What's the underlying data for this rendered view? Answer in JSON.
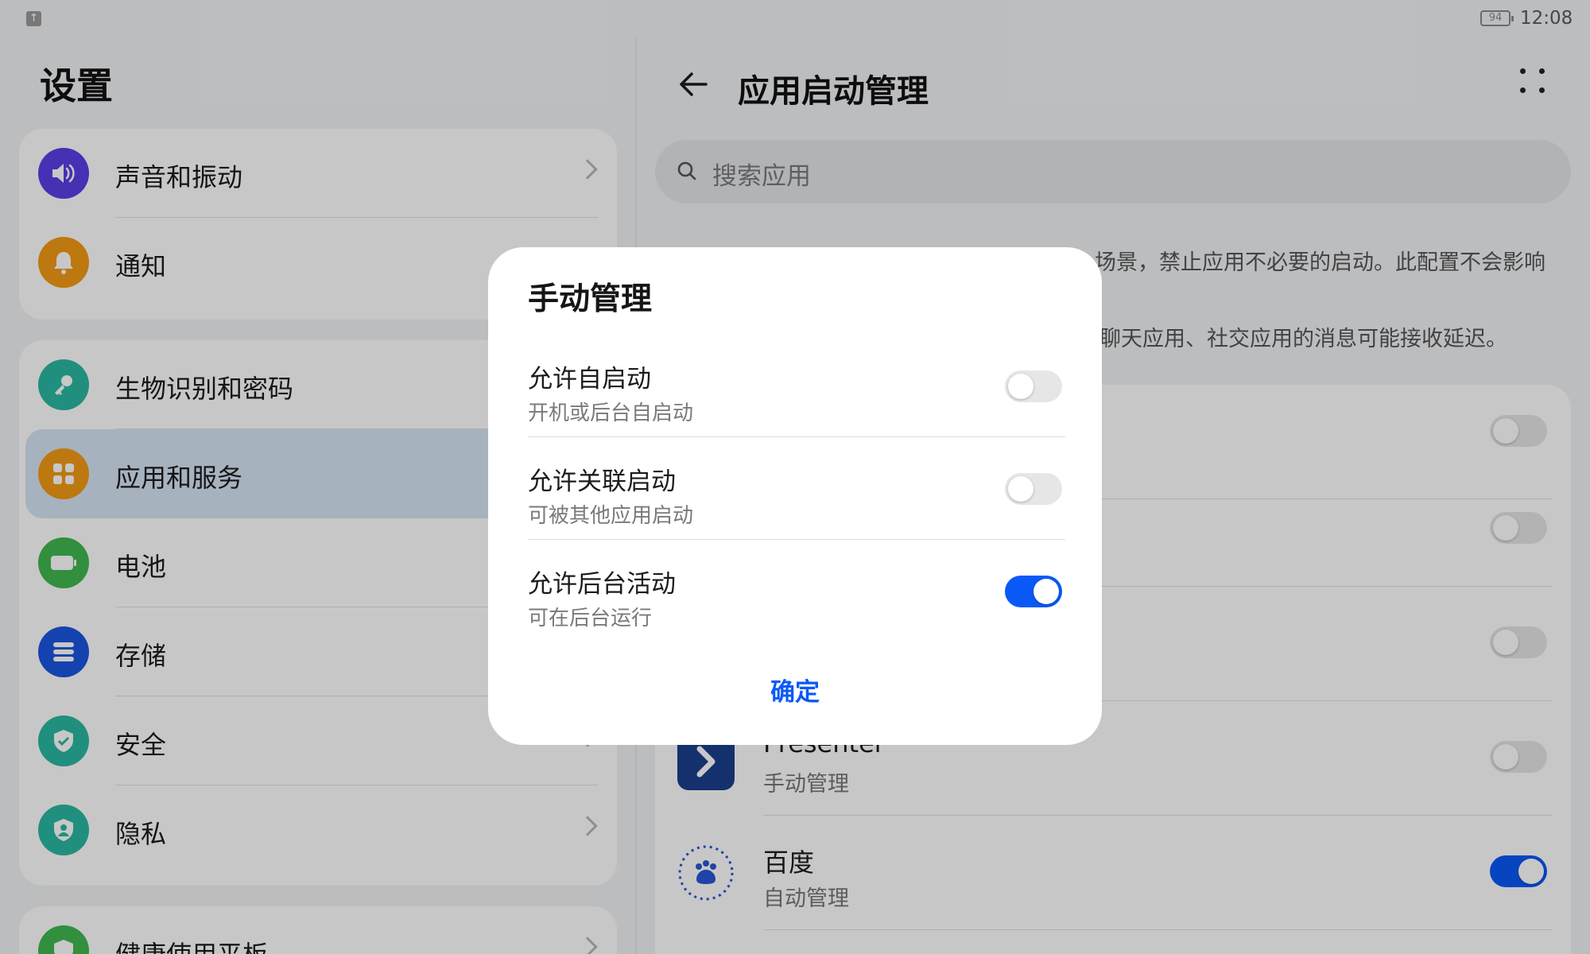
{
  "status": {
    "battery": "94",
    "time": "12:08"
  },
  "left": {
    "title": "设置",
    "items": [
      {
        "label": "声音和振动",
        "icon": "speaker-icon",
        "color": "#5a3ee6"
      },
      {
        "label": "通知",
        "icon": "bell-icon",
        "color": "#f39a14"
      },
      {
        "label": "生物识别和密码",
        "icon": "key-icon",
        "color": "#2bb8a0"
      },
      {
        "label": "应用和服务",
        "icon": "apps-icon",
        "color": "#f39a14"
      },
      {
        "label": "电池",
        "icon": "battery-icon",
        "color": "#3fb850"
      },
      {
        "label": "存储",
        "icon": "storage-icon",
        "color": "#1a55e0"
      },
      {
        "label": "安全",
        "icon": "shield-check-icon",
        "color": "#2bb8a0"
      },
      {
        "label": "隐私",
        "icon": "privacy-icon",
        "color": "#2bb8a0"
      },
      {
        "label": "健康使用平板",
        "icon": "health-icon",
        "color": "#3fb850"
      }
    ]
  },
  "right": {
    "title": "应用启动管理",
    "search_placeholder": "搜索应用",
    "desc_line1": "场景，禁止应用不必要的启动。此配置不会影响",
    "desc_line2": "聊天应用、社交应用的消息可能接收延迟。",
    "apps": [
      {
        "name": "",
        "sub": "",
        "on": false
      },
      {
        "name": "",
        "sub": "",
        "on": false
      },
      {
        "name": "",
        "sub": "",
        "on": false
      },
      {
        "name": "Presenter",
        "sub": "手动管理",
        "on": false
      },
      {
        "name": "百度",
        "sub": "自动管理",
        "on": true
      }
    ]
  },
  "dialog": {
    "title": "手动管理",
    "rows": [
      {
        "label": "允许自启动",
        "sub": "开机或后台自启动",
        "on": false
      },
      {
        "label": "允许关联启动",
        "sub": "可被其他应用启动",
        "on": false
      },
      {
        "label": "允许后台活动",
        "sub": "可在后台运行",
        "on": true
      }
    ],
    "confirm": "确定"
  },
  "colors": {
    "accent": "#0a59f7"
  }
}
